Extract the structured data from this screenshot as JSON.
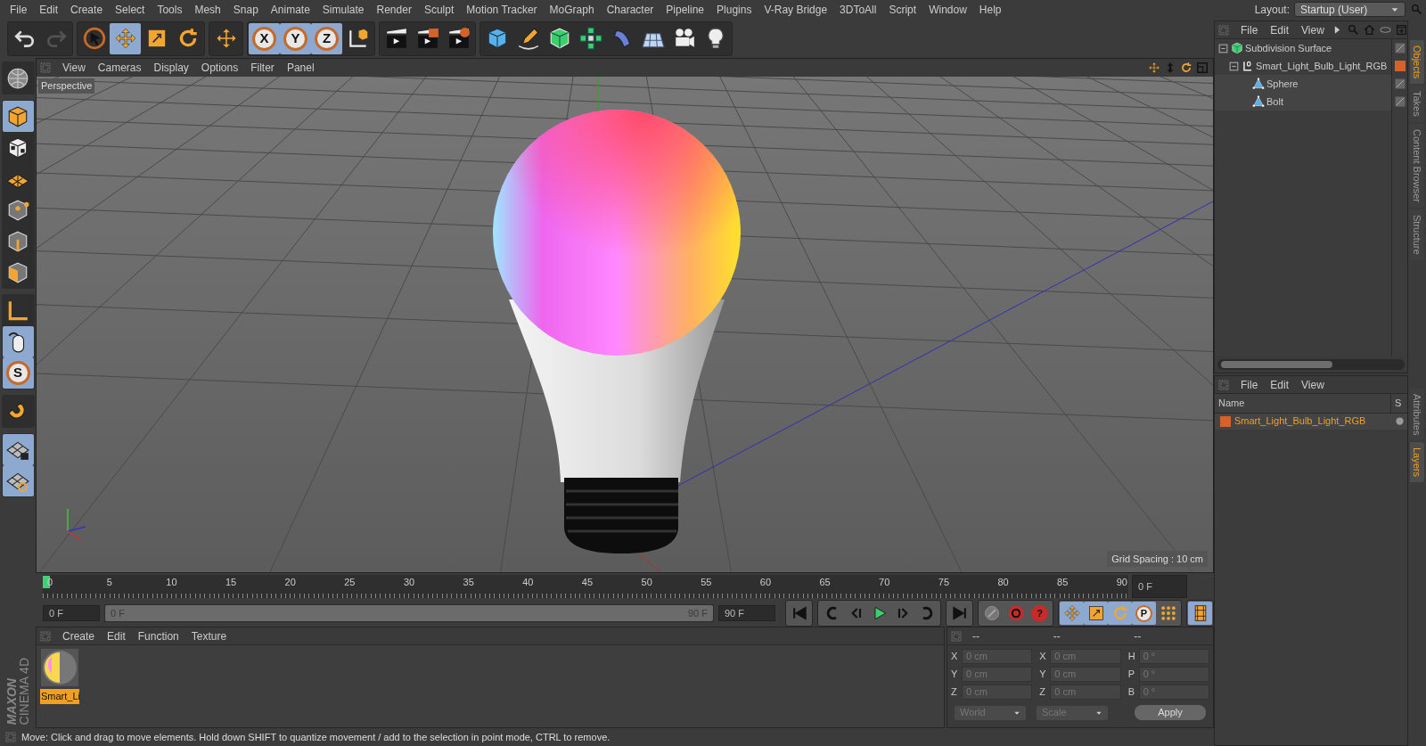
{
  "menu_bar": {
    "items": [
      "File",
      "Edit",
      "Create",
      "Select",
      "Tools",
      "Mesh",
      "Snap",
      "Animate",
      "Simulate",
      "Render",
      "Sculpt",
      "Motion Tracker",
      "MoGraph",
      "Character",
      "Pipeline",
      "Plugins",
      "V-Ray Bridge",
      "3DToAll",
      "Script",
      "Window",
      "Help"
    ],
    "layout_label": "Layout:",
    "layout_value": "Startup (User)"
  },
  "toolbar": {
    "groups": [
      [
        {
          "kind": "undo",
          "selected": false,
          "disabled": false
        },
        {
          "kind": "redo",
          "selected": false,
          "disabled": true
        }
      ],
      [
        {
          "kind": "select",
          "selected": false
        },
        {
          "kind": "move",
          "selected": true
        },
        {
          "kind": "scale",
          "selected": false
        },
        {
          "kind": "rotate",
          "selected": false
        }
      ],
      [
        {
          "kind": "transform",
          "selected": false
        }
      ],
      [
        {
          "kind": "axis",
          "label": "X",
          "selected": true
        },
        {
          "kind": "axis",
          "label": "Y",
          "selected": true
        },
        {
          "kind": "axis",
          "label": "Z",
          "selected": true
        },
        {
          "kind": "coordinates",
          "selected": false
        }
      ],
      [
        {
          "kind": "render-view",
          "selected": false
        },
        {
          "kind": "render-picture",
          "selected": false
        },
        {
          "kind": "render-settings",
          "selected": false
        }
      ],
      [
        {
          "kind": "cube",
          "selected": false
        },
        {
          "kind": "pen",
          "selected": false
        },
        {
          "kind": "subdivision",
          "selected": false
        },
        {
          "kind": "cloner",
          "selected": false
        },
        {
          "kind": "deformer",
          "selected": false
        },
        {
          "kind": "floor",
          "selected": false
        },
        {
          "kind": "camera",
          "selected": false
        },
        {
          "kind": "light",
          "selected": false
        }
      ]
    ]
  },
  "side_toolbar": {
    "groups": [
      [
        {
          "kind": "make-editable",
          "selected": false
        }
      ],
      [
        {
          "kind": "model",
          "selected": true
        },
        {
          "kind": "texture",
          "selected": false
        },
        {
          "kind": "workplane",
          "selected": false
        },
        {
          "kind": "points",
          "selected": false
        },
        {
          "kind": "edges",
          "selected": false
        },
        {
          "kind": "polygons",
          "selected": false
        }
      ],
      [
        {
          "kind": "axis-mode",
          "selected": false
        },
        {
          "kind": "tweak",
          "selected": true
        },
        {
          "kind": "snap",
          "label": "S",
          "selected": true
        }
      ],
      [
        {
          "kind": "magnet",
          "selected": false
        }
      ],
      [
        {
          "kind": "grid-lock",
          "selected": true
        },
        {
          "kind": "grid-snap",
          "selected": true
        }
      ]
    ]
  },
  "viewport": {
    "menu": [
      "View",
      "Cameras",
      "Display",
      "Options",
      "Filter",
      "Panel"
    ],
    "camera_label": "Perspective",
    "grid_spacing": "Grid Spacing : 10 cm"
  },
  "timeline": {
    "ticks": [
      "0",
      "5",
      "10",
      "15",
      "20",
      "25",
      "30",
      "35",
      "40",
      "45",
      "50",
      "55",
      "60",
      "65",
      "70",
      "75",
      "80",
      "85",
      "90"
    ],
    "current_frame": "0 F"
  },
  "playback": {
    "start_field": "0 F",
    "range": {
      "start": "0 F",
      "end": "90 F"
    },
    "end_field": "90 F",
    "groups": [
      [
        {
          "kind": "first",
          "selected": false
        }
      ],
      [
        {
          "kind": "prev-key",
          "selected": false
        },
        {
          "kind": "prev-frame",
          "selected": false
        },
        {
          "kind": "play",
          "selected": false
        },
        {
          "kind": "next-frame",
          "selected": false
        },
        {
          "kind": "next-key",
          "selected": false
        }
      ],
      [
        {
          "kind": "last",
          "selected": false
        }
      ],
      [
        {
          "kind": "keyframe-lock",
          "selected": false
        },
        {
          "kind": "record",
          "selected": false
        },
        {
          "kind": "autokey",
          "label": "?",
          "selected": false
        }
      ],
      [
        {
          "kind": "move",
          "selected": true
        },
        {
          "kind": "scale",
          "selected": true
        },
        {
          "kind": "rotate",
          "selected": true
        },
        {
          "kind": "param",
          "label": "P",
          "selected": true
        },
        {
          "kind": "dots",
          "selected": false
        }
      ],
      [
        {
          "kind": "film",
          "selected": true
        }
      ]
    ]
  },
  "materials": {
    "menu": [
      "Create",
      "Edit",
      "Function",
      "Texture"
    ],
    "items": [
      {
        "name": "Smart_Li",
        "selected": true
      }
    ]
  },
  "coordinates": {
    "headers": [
      "--",
      "--",
      "--"
    ],
    "rows": [
      [
        {
          "axis": "X",
          "value": "0 cm"
        },
        {
          "axis": "X",
          "value": "0 cm"
        },
        {
          "axis": "H",
          "value": "0 °"
        }
      ],
      [
        {
          "axis": "Y",
          "value": "0 cm"
        },
        {
          "axis": "Y",
          "value": "0 cm"
        },
        {
          "axis": "P",
          "value": "0 °"
        }
      ],
      [
        {
          "axis": "Z",
          "value": "0 cm"
        },
        {
          "axis": "Z",
          "value": "0 cm"
        },
        {
          "axis": "B",
          "value": "0 °"
        }
      ]
    ],
    "dropdowns": [
      "World",
      "Scale"
    ],
    "apply": "Apply"
  },
  "logo": {
    "brand": "MAXON",
    "product": "CINEMA 4D"
  },
  "status_bar": "Move: Click and drag to move elements. Hold down SHIFT to quantize movement / add to the selection in point mode, CTRL to remove.",
  "objects": {
    "menu": [
      "File",
      "Edit",
      "View"
    ],
    "tree": [
      {
        "name": "Subdivision Surface",
        "kind": "subdivision",
        "expanded": true,
        "children": [
          {
            "name": "Smart_Light_Bulb_Light_RGB",
            "kind": "null",
            "expanded": true,
            "color": "#d4622a",
            "children": [
              {
                "name": "Sphere",
                "kind": "polygon"
              },
              {
                "name": "Bolt",
                "kind": "polygon"
              }
            ]
          }
        ]
      }
    ]
  },
  "layers": {
    "menu": [
      "File",
      "Edit",
      "View"
    ],
    "columns": [
      "Name",
      "S"
    ],
    "rows": [
      {
        "name": "Smart_Light_Bulb_Light_RGB",
        "color": "#d4622a"
      }
    ]
  },
  "side_tabs": {
    "top": [
      {
        "label": "Objects",
        "selected": true
      },
      {
        "label": "Takes",
        "selected": false
      },
      {
        "label": "Content Browser",
        "selected": false
      },
      {
        "label": "Structure",
        "selected": false
      }
    ],
    "bottom": [
      {
        "label": "Attributes",
        "selected": false
      },
      {
        "label": "Layers",
        "selected": true
      }
    ]
  }
}
